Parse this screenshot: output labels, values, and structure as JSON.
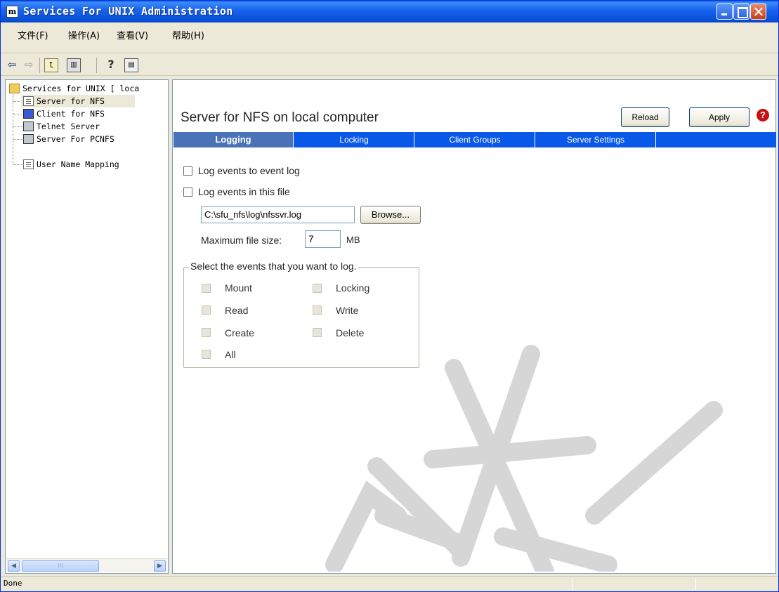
{
  "window": {
    "title": "Services For UNIX Administration",
    "icon_text": "m"
  },
  "menu": {
    "file": "文件(F)",
    "action": "操作(A)",
    "view": "查看(V)",
    "help": "帮助(H)"
  },
  "toolbar": {
    "back": "⇦",
    "forward": "⇨",
    "up": "⮤",
    "tree": "▥",
    "help": "?",
    "pane": "▤"
  },
  "tree": {
    "root": "Services for UNIX [ loca",
    "items": [
      {
        "label": "Server for NFS",
        "icon": "server-icon",
        "selected": true
      },
      {
        "label": "Client for NFS",
        "icon": "client-icon"
      },
      {
        "label": "Telnet Server",
        "icon": "telnet-icon"
      },
      {
        "label": "Server For PCNFS",
        "icon": "telnet-icon"
      },
      {
        "label": "User Name Mapping",
        "icon": "server-icon"
      }
    ],
    "scroll_thumb": "III"
  },
  "content": {
    "title": "Server for NFS on local computer",
    "reload": "Reload",
    "apply": "Apply",
    "help_glyph": "?",
    "tabs": [
      "Logging",
      "Locking",
      "Client Groups",
      "Server Settings"
    ],
    "active_tab": "Logging",
    "logging": {
      "log_event_label": "Log events to event log",
      "log_file_label": "Log events in this file",
      "log_path": "C:\\sfu_nfs\\log\\nfssvr.log",
      "browse": "Browse...",
      "max_size_label": "Maximum file size:",
      "max_size_value": "7",
      "max_size_unit": "MB",
      "events_legend": "Select the events that you want to log.",
      "events": {
        "mount": "Mount",
        "locking": "Locking",
        "read": "Read",
        "write": "Write",
        "create": "Create",
        "delete": "Delete",
        "all": "All"
      }
    }
  },
  "status": {
    "text": "Done"
  }
}
